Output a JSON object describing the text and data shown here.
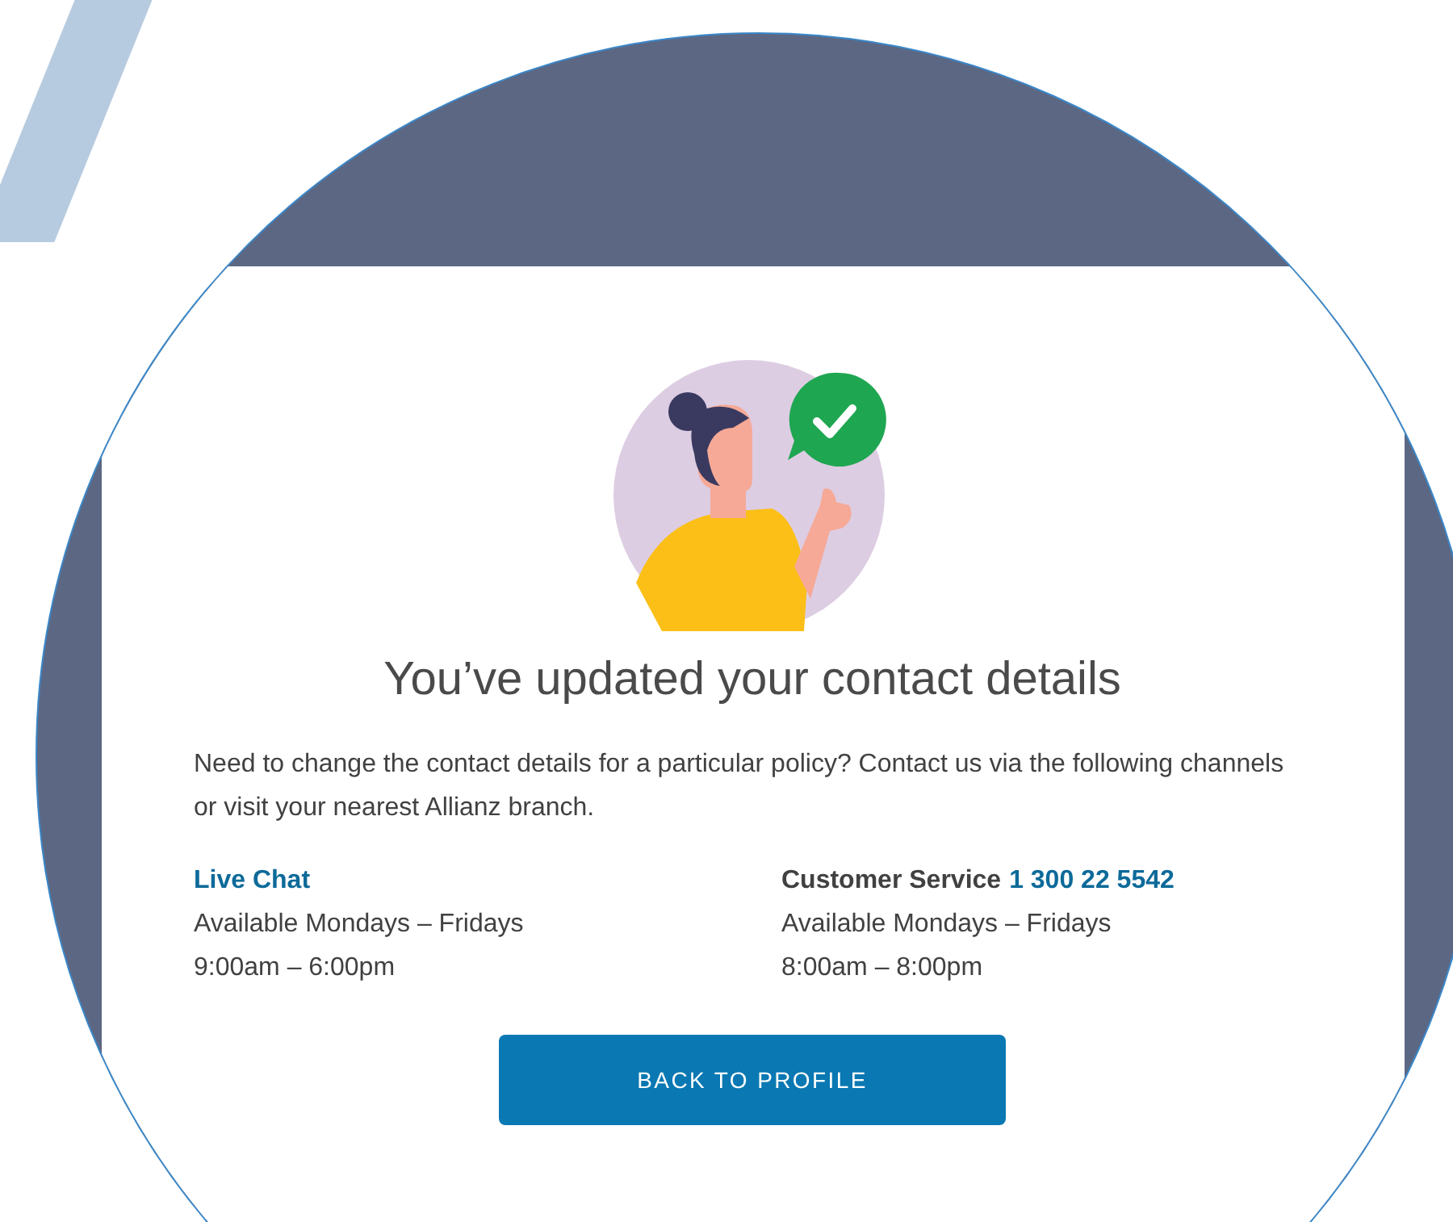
{
  "title": "You’ve updated your contact details",
  "message": "Need to change the contact details for a particular policy? Contact us via the following channels or visit your nearest Allianz branch.",
  "contacts": [
    {
      "kind": "link",
      "label": "Live Chat",
      "lines": [
        "Available Mondays – Fridays",
        "9:00am – 6:00pm"
      ]
    },
    {
      "kind": "phone",
      "label": "Customer Service",
      "phone": "1 300 22 5542",
      "lines": [
        "Available Mondays – Fridays",
        "8:00am – 8:00pm"
      ]
    }
  ],
  "button": "BACK TO PROFILE"
}
